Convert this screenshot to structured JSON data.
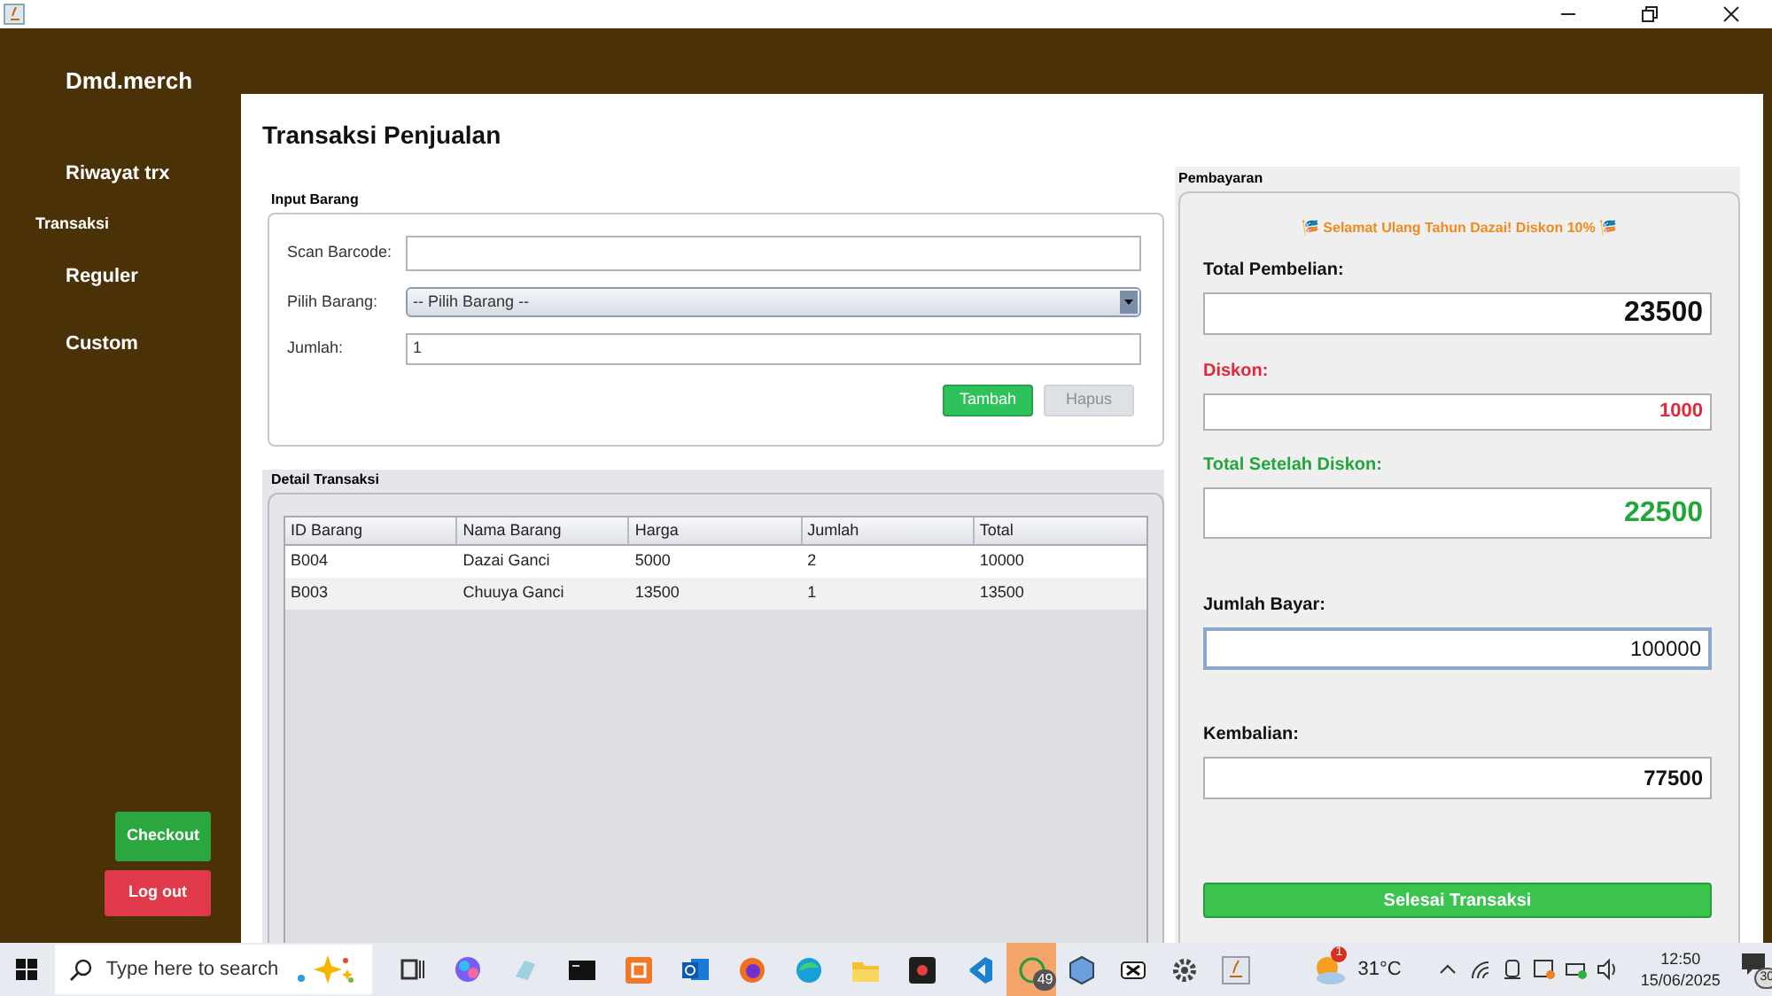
{
  "app": {
    "brand": "Dmd.merch"
  },
  "sidebar": {
    "items": [
      {
        "label": "Riwayat trx",
        "kind": "link"
      },
      {
        "label": "Transaksi",
        "kind": "heading"
      },
      {
        "label": "Reguler",
        "kind": "link"
      },
      {
        "label": "Custom",
        "kind": "link"
      }
    ],
    "buttons": [
      {
        "label": "Checkout",
        "kind": "primary"
      },
      {
        "label": "Log out",
        "kind": "danger"
      }
    ]
  },
  "page_title": "Transaksi Penjualan",
  "input_section": {
    "title": "Input Barang",
    "scan_label": "Scan Barcode:",
    "item_label": "Pilih Barang:",
    "item_value": "-- Pilih Barang --",
    "qty_label": "Jumlah:",
    "qty_value": "1",
    "buttons": [
      {
        "label": "Tambah",
        "disabled": false
      },
      {
        "label": "Hapus",
        "disabled": true
      }
    ]
  },
  "detail_section": {
    "title": "Detail Transaksi",
    "table": {
      "columns": [
        "ID Barang",
        "Nama Barang",
        "Harga",
        "Jumlah",
        "Total"
      ],
      "rows": [
        [
          "B004",
          "Dazai Ganci",
          "5000",
          "2",
          "10000"
        ],
        [
          "B003",
          "Chuuya Ganci",
          "13500",
          "1",
          "13500"
        ]
      ]
    }
  },
  "payment": {
    "title": "Pembayaran",
    "banner": "🎏 Selamat Ulang Tahun Dazai! Diskon 10% 🎏",
    "fields": [
      {
        "label": "Total Pembelian:",
        "value": "23500",
        "kind": "large",
        "color": "#111111",
        "focused": false
      },
      {
        "label": "Diskon:",
        "value": "1000",
        "kind": "small",
        "color": "#e0283c",
        "focused": false
      },
      {
        "label": "Total Setelah Diskon:",
        "value": "22500",
        "kind": "large",
        "color": "#22a63a",
        "focused": false
      },
      {
        "label": "Jumlah Bayar:",
        "value": "100000",
        "kind": "medium",
        "color": "#111111",
        "focused": true
      },
      {
        "label": "Kembalian:",
        "value": "77500",
        "kind": "medium",
        "color": "#111111",
        "focused": false
      }
    ],
    "finish_button": "Selesai Transaksi"
  },
  "taskbar": {
    "search_placeholder": "Type here to search",
    "whatsapp_badge": "49",
    "weather_badge": "1",
    "temperature": "31°C",
    "time": "12:50",
    "date": "15/06/2025",
    "notifications": "30"
  }
}
